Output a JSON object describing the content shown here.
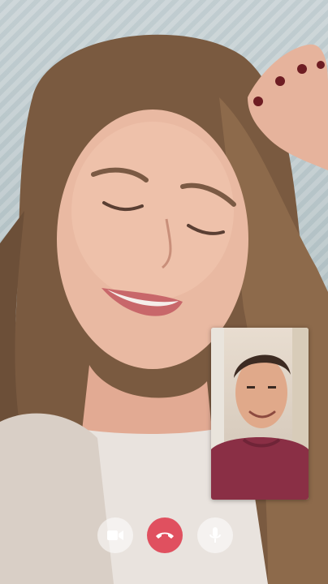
{
  "call": {
    "remote_feed": "remote-participant-video",
    "self_feed": "self-view-video"
  },
  "controls": [
    {
      "id": "video",
      "icon": "video-camera-icon"
    },
    {
      "id": "end",
      "icon": "phone-hangup-icon",
      "color": "#e0505f"
    },
    {
      "id": "mic",
      "icon": "microphone-icon"
    }
  ]
}
